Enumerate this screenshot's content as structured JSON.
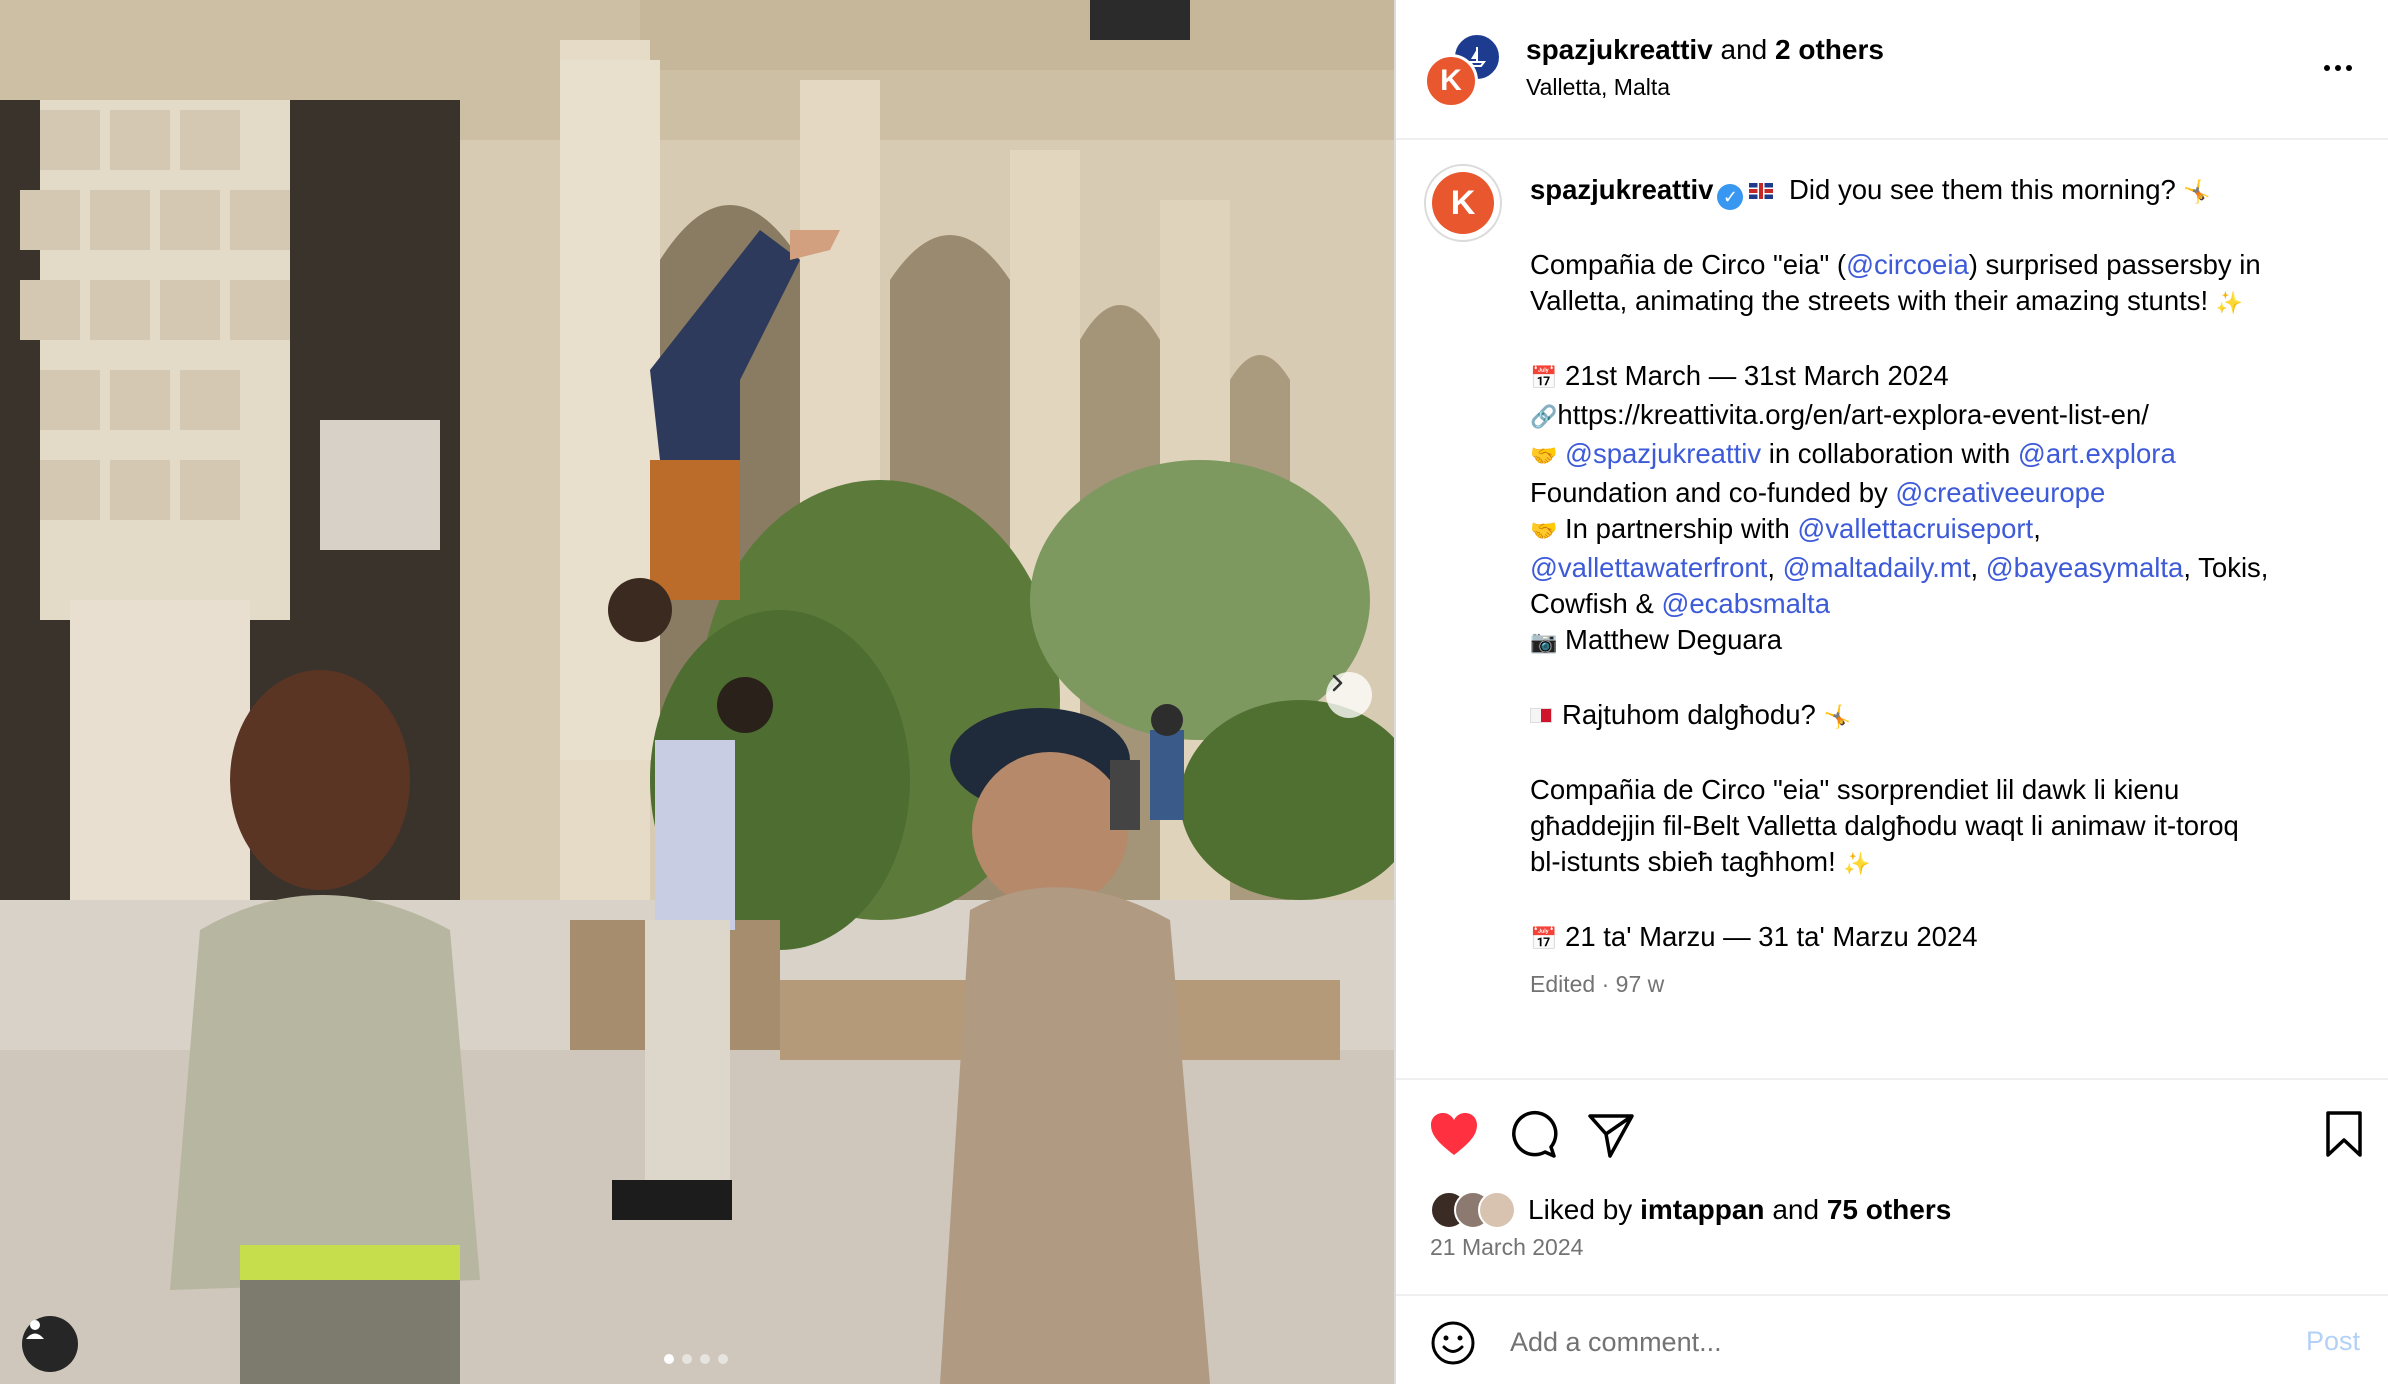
{
  "header": {
    "username": "spazjukreattiv",
    "connector": "and",
    "others": "2 others",
    "location": "Valletta, Malta",
    "avatar_letter": "K"
  },
  "caption": {
    "avatar_letter": "K",
    "username": "spazjukreattiv",
    "line1_text": " Did you see them this morning? ",
    "p1a_pre": "Compañia de Circo \"eia\" (",
    "p1a_mention": "@circoeia",
    "p1a_post": ") surprised passersby in",
    "p1b": "Valletta, animating the streets with their amazing stunts! ",
    "dates_en": "21st March — 31st March 2024",
    "link": "https://kreattivita.org/en/art-explora-event-list-en/",
    "collab_mention1": "@spazjukreattiv",
    "collab_mid": " in collaboration with ",
    "collab_mention2": "@art.explora",
    "foundation_pre": "Foundation and co-funded by ",
    "foundation_mention": "@creativeeurope",
    "partner_pre": "In partnership with ",
    "partner_m1": "@vallettacruiseport",
    "comma1": ",",
    "partner_m2": "@vallettawaterfront",
    "comma2": ", ",
    "partner_m3": "@maltadaily.mt",
    "comma3": ", ",
    "partner_m4": "@bayeasymalta",
    "partner_tail": ", Tokis,",
    "cowfish_pre": "Cowfish & ",
    "partner_m5": "@ecabsmalta",
    "photographer": "Matthew Deguara",
    "mt_question": "Rajtuhom dalgħodu? ",
    "mt_p1": "Compañia de Circo \"eia\" ssorprendiet lil dawk li kienu",
    "mt_p2": "għaddejjin fil-Belt Valletta dalgħodu waqt li animaw it-toroq",
    "mt_p3": "bl-istunts sbieħ tagħhom! ",
    "dates_mt": "21 ta' Marzu — 31 ta' Marzu 2024",
    "meta": "Edited · 97 w"
  },
  "actions": {
    "liked_by_prefix": "Liked by ",
    "liked_by_user": "imtappan",
    "liked_by_and": " and ",
    "liked_by_others": "75 others",
    "date": "21 March 2024",
    "comment_placeholder": "Add a comment...",
    "post_label": "Post"
  },
  "carousel": {
    "total_slides": 4,
    "active_slide": 1
  },
  "colors": {
    "accent_blue": "#3d5ad8",
    "like_red": "#ff3040",
    "brand_orange": "#e9572f",
    "post_disabled": "#b3d1f7"
  },
  "icons": [
    "heart-icon",
    "comment-icon",
    "share-icon",
    "bookmark-icon",
    "emoji-icon",
    "more-icon",
    "chevron-right-icon",
    "user-tag-icon",
    "verified-icon"
  ]
}
